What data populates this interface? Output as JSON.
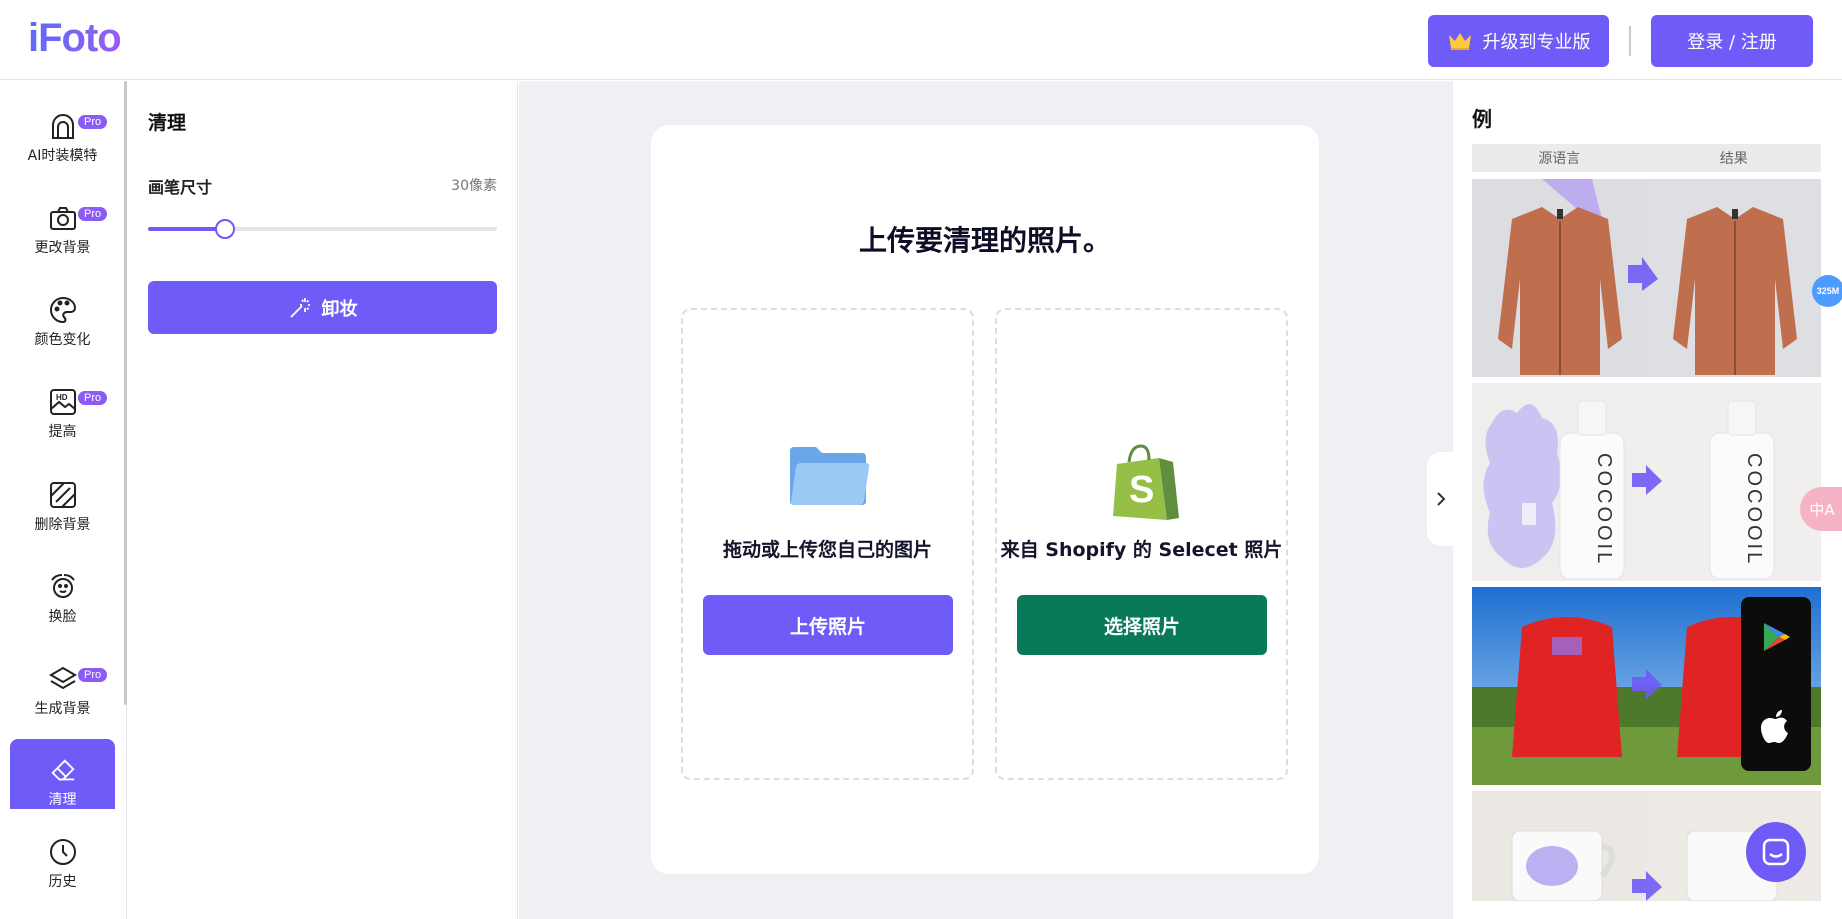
{
  "header": {
    "logo": "iFoto",
    "upgrade_label": "升级到专业版",
    "login_label": "登录 / 注册"
  },
  "nav": {
    "pro_badge": "Pro",
    "items": [
      {
        "label": "AI时装模特",
        "pro": true,
        "icon": "model-icon"
      },
      {
        "label": "更改背景",
        "pro": true,
        "icon": "camera-icon"
      },
      {
        "label": "颜色变化",
        "pro": false,
        "icon": "palette-icon"
      },
      {
        "label": "提高",
        "pro": true,
        "icon": "hd-image-icon"
      },
      {
        "label": "删除背景",
        "pro": false,
        "icon": "remove-bg-icon"
      },
      {
        "label": "换脸",
        "pro": false,
        "icon": "face-swap-icon"
      },
      {
        "label": "生成背景",
        "pro": true,
        "icon": "layers-icon"
      },
      {
        "label": "清理",
        "pro": false,
        "icon": "eraser-icon",
        "active": true
      },
      {
        "label": "历史",
        "pro": false,
        "icon": "clock-icon"
      }
    ]
  },
  "panel": {
    "title": "清理",
    "brush_label": "画笔尺寸",
    "brush_value": "30像素",
    "brush_level_fraction": 0.22,
    "action_label": "卸妆"
  },
  "workspace": {
    "heading": "上传要清理的照片。",
    "local": {
      "caption": "拖动或上传您自己的图片",
      "button": "上传照片"
    },
    "shopify": {
      "caption": "来自 Shopify 的 Selecet 照片",
      "button": "选择照片"
    }
  },
  "examples": {
    "title": "例",
    "col_source": "源语言",
    "col_result": "结果"
  },
  "floating": {
    "badge": "325M",
    "translate": "中A"
  },
  "colors": {
    "accent": "#6f5bf7",
    "shopify_green": "#087a5a",
    "workspace_bg": "#eef0f3"
  }
}
